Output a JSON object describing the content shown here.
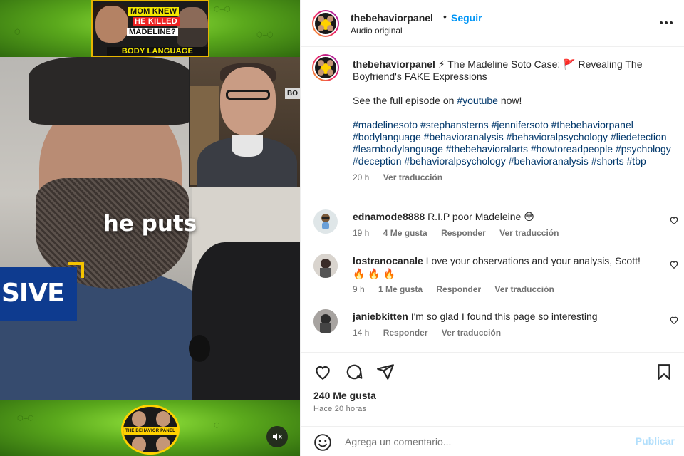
{
  "video": {
    "thumbnail": {
      "line1": "MOM KNEW",
      "line2": "HE KILLED",
      "line3": "MADELINE?",
      "line4": "BODY LANGUAGE"
    },
    "caption": "he puts",
    "banner_text": "SIVE",
    "inset_sign": "BO",
    "logo_text": "THE BEHAVIOR PANEL",
    "mute_icon": "speaker-muted-icon"
  },
  "header": {
    "username": "thebehaviorpanel",
    "separator": "•",
    "follow_label": "Seguir",
    "subtitle": "Audio original",
    "more_icon": "more-horizontal-icon"
  },
  "caption": {
    "username": "thebehaviorpanel",
    "title": " ⚡ The Madeline Soto Case: 🚩 Revealing The Boyfriend's FAKE Expressions",
    "line2": "See the full episode on ",
    "line2_tag": "#youtube",
    "line2_end": " now!",
    "hashtags": [
      "#madelinesoto",
      "#stephansterns",
      "#jennifersoto",
      "#thebehaviorpanel",
      "#bodylanguage",
      "#behavioranalysis",
      "#behavioralpsychology",
      "#liedetection",
      "#learnbodylanguage",
      "#thebehavioralarts",
      "#howtoreadpeople",
      "#psychology",
      "#deception",
      "#behavioralpsychology",
      "#behavioranalysis",
      "#shorts",
      "#tbp"
    ],
    "time": "20 h",
    "translate": "Ver traducción"
  },
  "comments": [
    {
      "username": "ednamode8888",
      "text": "R.I.P poor Madeleine 😳",
      "time": "19 h",
      "likes": "4 Me gusta",
      "reply": "Responder",
      "translate": "Ver traducción"
    },
    {
      "username": "lostranocanale",
      "text": "Love your observations and your analysis, Scott! 🔥 🔥 🔥",
      "time": "9 h",
      "likes": "1 Me gusta",
      "reply": "Responder",
      "translate": "Ver traducción"
    },
    {
      "username": "janiebkitten",
      "text": "I'm so glad I found this page so interesting",
      "time": "14 h",
      "likes": "",
      "reply": "Responder",
      "translate": "Ver traducción"
    }
  ],
  "actions": {
    "like_icon": "heart-icon",
    "comment_icon": "comment-bubble-icon",
    "share_icon": "paper-plane-icon",
    "save_icon": "bookmark-icon",
    "likes_count": "240 Me gusta",
    "posted_ago": "Hace 20 horas"
  },
  "add_comment": {
    "emoji_icon": "smiley-icon",
    "placeholder": "Agrega un comentario...",
    "publish_label": "Publicar"
  },
  "colors": {
    "link_blue": "#0095f6",
    "hashtag": "#00376b",
    "muted_text": "#737373",
    "publish_disabled": "#b2dffc"
  }
}
